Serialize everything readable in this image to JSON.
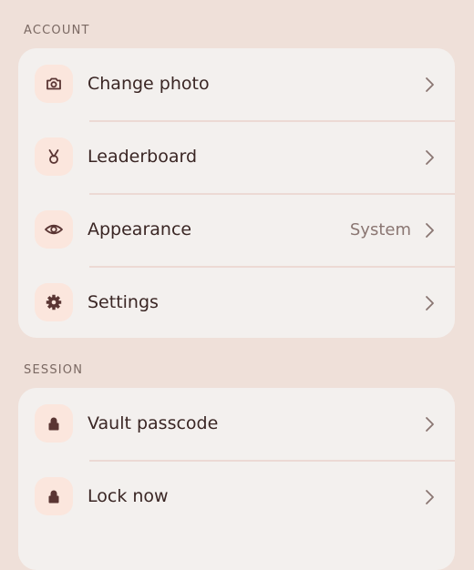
{
  "colors": {
    "background": "#efe0d9",
    "card": "#f3f0ee",
    "icon_chip": "#fbe6dd",
    "icon": "#5a3533",
    "text_primary": "#3a2624",
    "text_secondary": "#8a7672",
    "divider": "#ecd9d4"
  },
  "sections": {
    "account": {
      "header": "ACCOUNT",
      "items": [
        {
          "label": "Change photo",
          "icon": "camera-icon",
          "value": ""
        },
        {
          "label": "Leaderboard",
          "icon": "medal-icon",
          "value": ""
        },
        {
          "label": "Appearance",
          "icon": "eye-icon",
          "value": "System"
        },
        {
          "label": "Settings",
          "icon": "gear-icon",
          "value": ""
        }
      ]
    },
    "session": {
      "header": "SESSION",
      "items": [
        {
          "label": "Vault passcode",
          "icon": "lock-icon",
          "value": ""
        },
        {
          "label": "Lock now",
          "icon": "lock-icon",
          "value": ""
        }
      ]
    }
  }
}
